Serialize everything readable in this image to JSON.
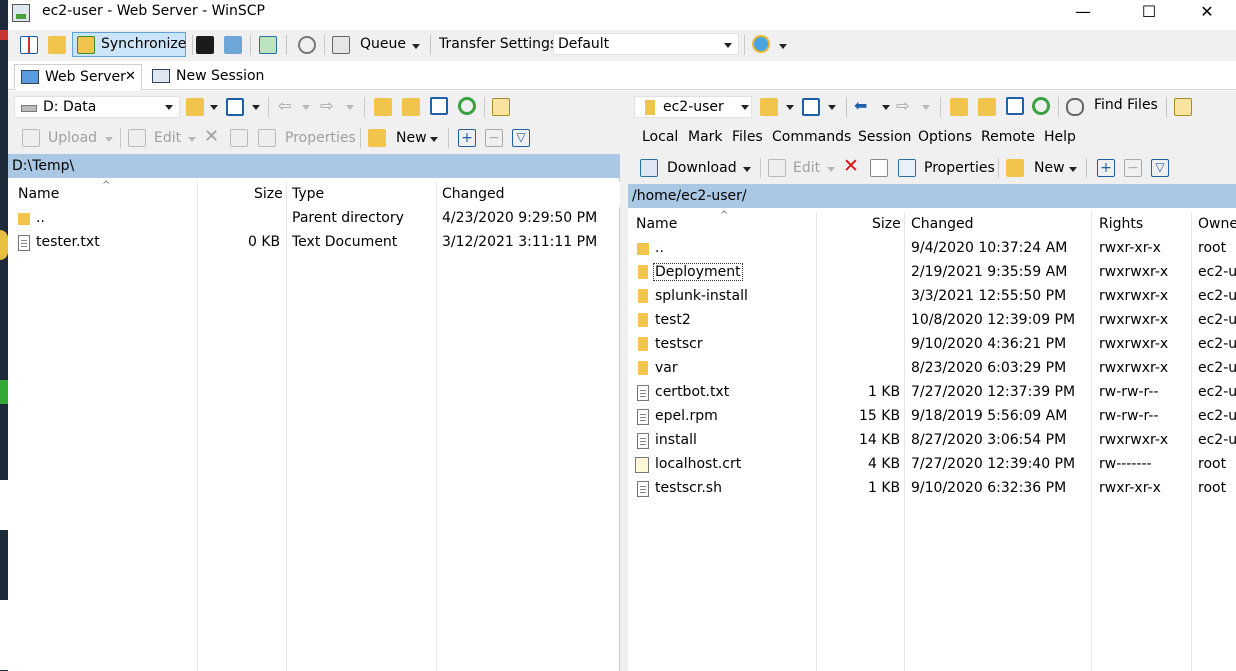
{
  "window": {
    "title": "ec2-user - Web Server - WinSCP",
    "minimize": "—",
    "maximize": "☐",
    "close": "✕"
  },
  "toolbar": {
    "synchronize": "Synchronize",
    "queue": "Queue",
    "transfer_settings": "Transfer Settings",
    "transfer_preset": "Default"
  },
  "tabs": [
    {
      "label": "Web Server",
      "close": "✕"
    },
    {
      "label": "New Session"
    }
  ],
  "local": {
    "drive": "D: Data",
    "actions": {
      "upload": "Upload",
      "edit": "Edit",
      "properties": "Properties",
      "new": "New"
    },
    "path": "D:\\Temp\\",
    "columns": [
      "Name",
      "Size",
      "Type",
      "Changed"
    ],
    "rows": [
      {
        "name": "..",
        "size": "",
        "type": "Parent directory",
        "changed": "4/23/2020  9:29:50 PM",
        "icon": "parent-dir-icon"
      },
      {
        "name": "tester.txt",
        "size": "0 KB",
        "type": "Text Document",
        "changed": "3/12/2021  3:11:11 PM",
        "icon": "text-file-icon"
      }
    ]
  },
  "remote": {
    "folder": "ec2-user",
    "find_files": "Find Files",
    "menu": [
      "Local",
      "Mark",
      "Files",
      "Commands",
      "Session",
      "Options",
      "Remote",
      "Help"
    ],
    "actions": {
      "download": "Download",
      "edit": "Edit",
      "properties": "Properties",
      "new": "New"
    },
    "path": "/home/ec2-user/",
    "columns": [
      "Name",
      "Size",
      "Changed",
      "Rights",
      "Owne"
    ],
    "rows": [
      {
        "name": "..",
        "size": "",
        "changed": "9/4/2020 10:37:24 AM",
        "rights": "rwxr-xr-x",
        "owner": "root",
        "icon": "parent-dir-icon"
      },
      {
        "name": "Deployment",
        "size": "",
        "changed": "2/19/2021 9:35:59 AM",
        "rights": "rwxrwxr-x",
        "owner": "ec2-u",
        "icon": "folder-icon"
      },
      {
        "name": "splunk-install",
        "size": "",
        "changed": "3/3/2021 12:55:50 PM",
        "rights": "rwxrwxr-x",
        "owner": "ec2-u",
        "icon": "folder-icon"
      },
      {
        "name": "test2",
        "size": "",
        "changed": "10/8/2020 12:39:09 PM",
        "rights": "rwxrwxr-x",
        "owner": "ec2-u",
        "icon": "folder-icon"
      },
      {
        "name": "testscr",
        "size": "",
        "changed": "9/10/2020 4:36:21 PM",
        "rights": "rwxrwxr-x",
        "owner": "ec2-u",
        "icon": "folder-icon"
      },
      {
        "name": "var",
        "size": "",
        "changed": "8/23/2020 6:03:29 PM",
        "rights": "rwxrwxr-x",
        "owner": "ec2-u",
        "icon": "folder-icon"
      },
      {
        "name": "certbot.txt",
        "size": "1 KB",
        "changed": "7/27/2020 12:37:39 PM",
        "rights": "rw-rw-r--",
        "owner": "ec2-u",
        "icon": "text-file-icon"
      },
      {
        "name": "epel.rpm",
        "size": "15 KB",
        "changed": "9/18/2019 5:56:09 AM",
        "rights": "rw-rw-r--",
        "owner": "ec2-u",
        "icon": "file-icon"
      },
      {
        "name": "install",
        "size": "14 KB",
        "changed": "8/27/2020 3:06:54 PM",
        "rights": "rwxrwxr-x",
        "owner": "ec2-u",
        "icon": "file-icon"
      },
      {
        "name": "localhost.crt",
        "size": "4 KB",
        "changed": "7/27/2020 12:39:40 PM",
        "rights": "rw-------",
        "owner": "root",
        "icon": "certificate-icon"
      },
      {
        "name": "testscr.sh",
        "size": "1 KB",
        "changed": "9/10/2020 6:32:36 PM",
        "rights": "rwxr-xr-x",
        "owner": "root",
        "icon": "file-icon"
      }
    ]
  }
}
